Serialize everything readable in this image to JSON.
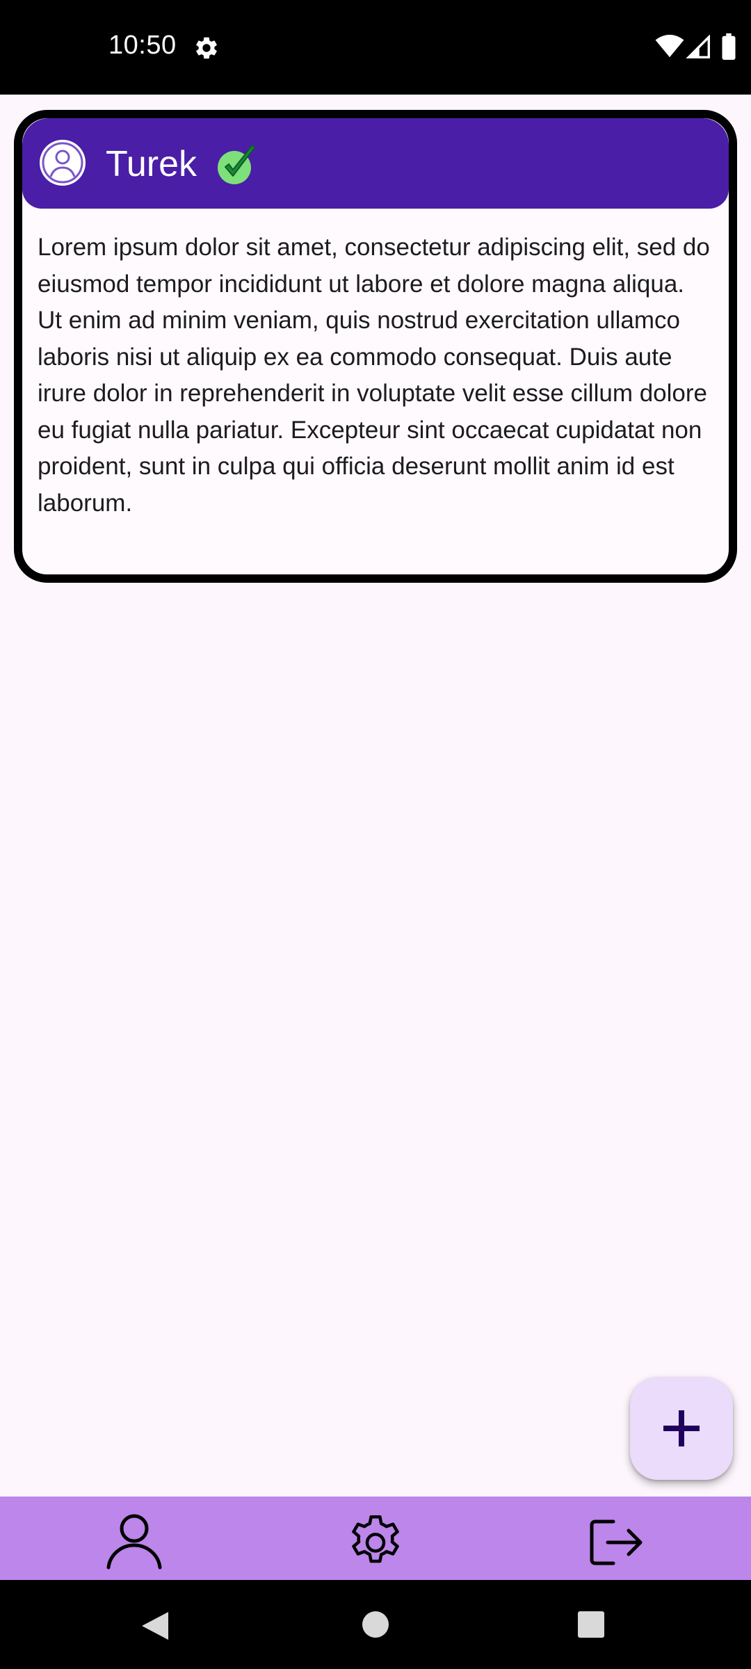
{
  "status_bar": {
    "time": "10:50",
    "icons": [
      "gear-icon",
      "wifi-icon",
      "cellular-signal-icon",
      "battery-icon"
    ]
  },
  "post": {
    "author": "Turek",
    "avatar_icon": "user-circle-icon",
    "verified_icon": "verified-check-icon",
    "body": "Lorem ipsum dolor sit amet, consectetur adipiscing elit, sed do eiusmod tempor incididunt ut labore et dolore magna aliqua. Ut enim ad minim veniam, quis nostrud exercitation ullamco laboris nisi ut aliquip ex ea commodo consequat. Duis aute irure dolor in reprehenderit in voluptate velit esse cillum dolore eu fugiat nulla pariatur. Excepteur sint occaecat cupidatat non proident, sunt in culpa qui officia deserunt mollit anim id est laborum."
  },
  "fab": {
    "icon": "plus-icon"
  },
  "bottom_nav": {
    "items": [
      {
        "id": "profile",
        "icon": "person-icon"
      },
      {
        "id": "settings",
        "icon": "gear-icon"
      },
      {
        "id": "logout",
        "icon": "logout-icon"
      }
    ]
  },
  "system_nav": {
    "icons": [
      "back-icon",
      "home-icon",
      "recents-icon"
    ]
  },
  "colors": {
    "header": "#4a1ea6",
    "bottom_nav": "#bc86ea",
    "fab": "#eadcfa",
    "background": "#fdf7fd",
    "verified": "#2bb44a"
  }
}
